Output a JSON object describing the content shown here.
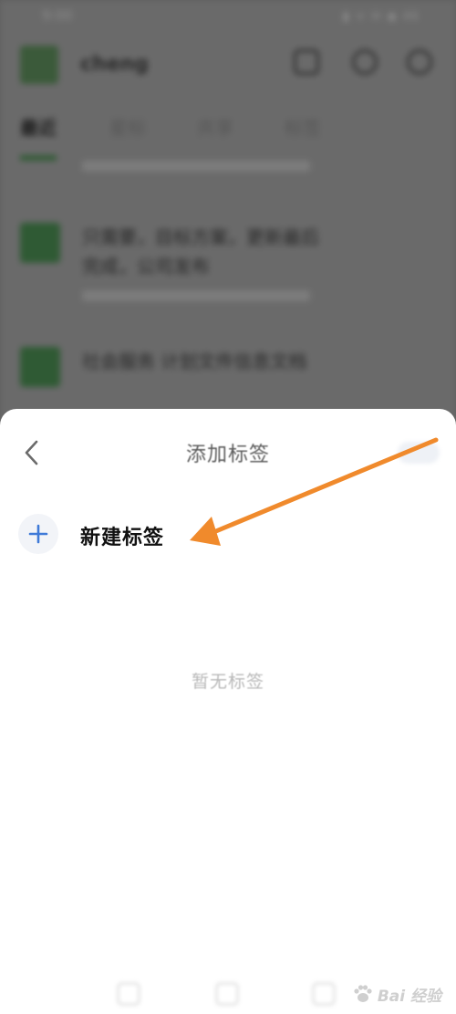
{
  "background_app": {
    "status_time": "9:00",
    "status_icons": "▮ ᯤ ✉ ◉ 46",
    "app_name": "cheng",
    "tabs": [
      {
        "label": "最近"
      },
      {
        "label": "星标"
      },
      {
        "label": "共享"
      },
      {
        "label": "标签"
      }
    ],
    "documents": [
      {
        "title": "只需要，目标方案，更新最后完成，公司发布"
      },
      {
        "title": "社会服务 计划文件信息文档"
      }
    ]
  },
  "sheet": {
    "title": "添加标签",
    "new_tag_label": "新建标签",
    "empty_hint": "暂无标签"
  },
  "watermark": {
    "text": "Bai 经验"
  },
  "colors": {
    "accent_blue": "#3f7ad8",
    "arrow_orange": "#f08a2c",
    "sheet_bg": "#ffffff",
    "overlay_dim": "#6a6a6a"
  }
}
